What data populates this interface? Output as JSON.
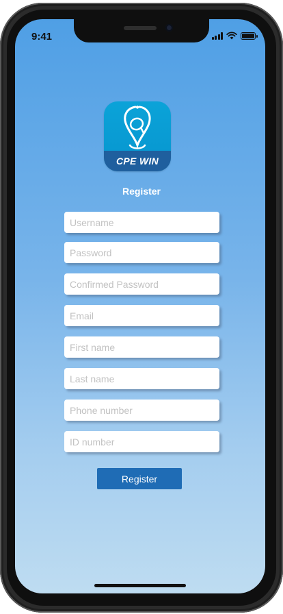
{
  "status_bar": {
    "time": "9:41"
  },
  "app": {
    "logo_text": "CPE WIN",
    "title": "Register"
  },
  "form": {
    "fields": [
      {
        "placeholder": "Username"
      },
      {
        "placeholder": "Password"
      },
      {
        "placeholder": "Confirmed Password"
      },
      {
        "placeholder": "Email"
      },
      {
        "placeholder": "First name"
      },
      {
        "placeholder": "Last name"
      },
      {
        "placeholder": "Phone number"
      },
      {
        "placeholder": "ID number"
      }
    ],
    "submit_label": "Register"
  },
  "colors": {
    "gradient_top": "#4f9fe5",
    "gradient_bottom": "#bedcf1",
    "button": "#1f6cb5",
    "logo_band": "#1f5f9e"
  }
}
